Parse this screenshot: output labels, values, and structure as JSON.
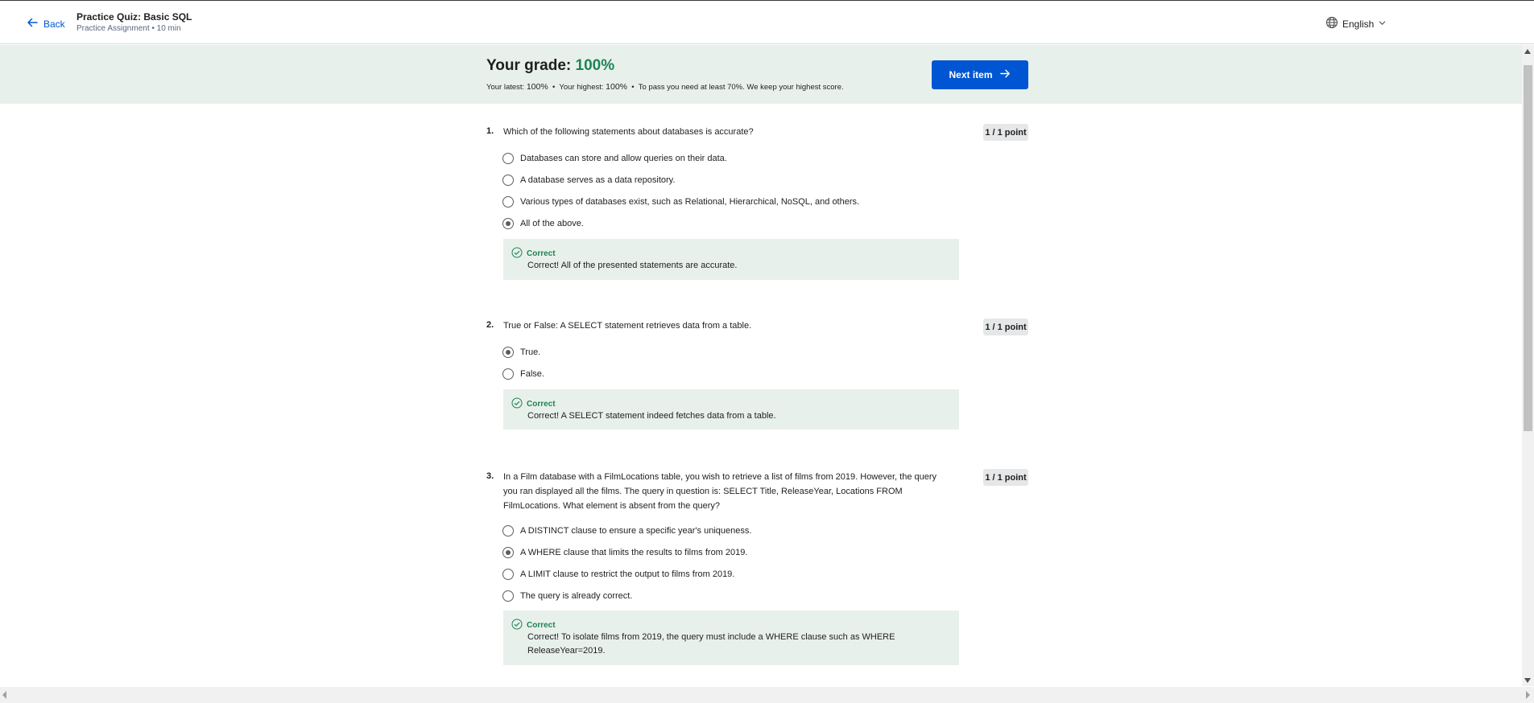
{
  "header": {
    "back_label": "Back",
    "title": "Practice Quiz: Basic SQL",
    "subtitle": "Practice Assignment • 10 min",
    "language": "English"
  },
  "grade": {
    "label": "Your grade:",
    "value": "100%",
    "latest_label": "Your latest:",
    "latest_value": "100%",
    "highest_label": "Your highest:",
    "highest_value": "100%",
    "pass_note": "To pass you need at least 70%. We keep your highest score.",
    "next_label": "Next item"
  },
  "questions": [
    {
      "number": "1.",
      "text": "Which of the following statements about databases is accurate?",
      "points": "1 / 1 point",
      "options": [
        {
          "label": "Databases can store and allow queries on their data.",
          "selected": false
        },
        {
          "label": "A database serves as a data repository.",
          "selected": false
        },
        {
          "label": "Various types of databases exist, such as Relational, Hierarchical, NoSQL, and others.",
          "selected": false
        },
        {
          "label": "All of the above.",
          "selected": true
        }
      ],
      "feedback_title": "Correct",
      "feedback_text": "Correct! All of the presented statements are accurate."
    },
    {
      "number": "2.",
      "text": "True or False: A SELECT statement retrieves data from a table.",
      "points": "1 / 1 point",
      "options": [
        {
          "label": "True.",
          "selected": true
        },
        {
          "label": "False.",
          "selected": false
        }
      ],
      "feedback_title": "Correct",
      "feedback_text": "Correct! A SELECT statement indeed fetches data from a table."
    },
    {
      "number": "3.",
      "text": "In a Film database with a FilmLocations table, you wish to retrieve a list of films from 2019. However, the query you ran displayed all the films. The query in question is: SELECT Title, ReleaseYear, Locations FROM FilmLocations. What element is absent from the query?",
      "points": "1 / 1 point",
      "options": [
        {
          "label": "A DISTINCT clause to ensure a specific year's uniqueness.",
          "selected": false
        },
        {
          "label": "A WHERE clause that limits the results to films from 2019.",
          "selected": true
        },
        {
          "label": "A LIMIT clause to restrict the output to films from 2019.",
          "selected": false
        },
        {
          "label": "The query is already correct.",
          "selected": false
        }
      ],
      "feedback_title": "Correct",
      "feedback_text": "Correct! To isolate films from 2019, the query must include a WHERE clause such as WHERE ReleaseYear=2019."
    }
  ]
}
